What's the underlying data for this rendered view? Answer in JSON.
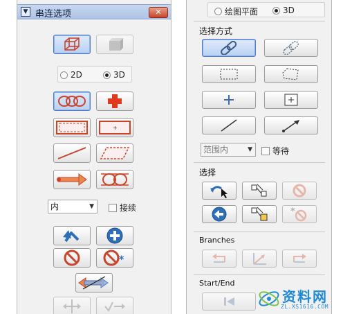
{
  "left_panel": {
    "title": "串连选项",
    "close_glyph": "✕",
    "mode_2d": "2D",
    "mode_3d": "3D",
    "mode_selected": "3D",
    "method_dropdown": {
      "value": "内"
    },
    "continue_checkbox": {
      "label": "接续",
      "checked": false
    }
  },
  "right_panel": {
    "top_radio": {
      "plane_label": "绘图平面",
      "label_3d": "3D",
      "selected": "3D"
    },
    "select_method_title": "选择方式",
    "range_dropdown": {
      "value": "范围内"
    },
    "wait_checkbox": {
      "label": "等待",
      "checked": false
    },
    "select_title": "选择",
    "branches_title": "Branches",
    "startend_title": "Start/End"
  },
  "watermark": {
    "text": "资料网",
    "url": "ZL.XS1616.COM"
  },
  "colors": {
    "accent_red": "#c8452b",
    "accent_blue": "#2f6fb8",
    "active_border": "#4a7cc9",
    "watermark_blue": "#1f8ad6"
  }
}
